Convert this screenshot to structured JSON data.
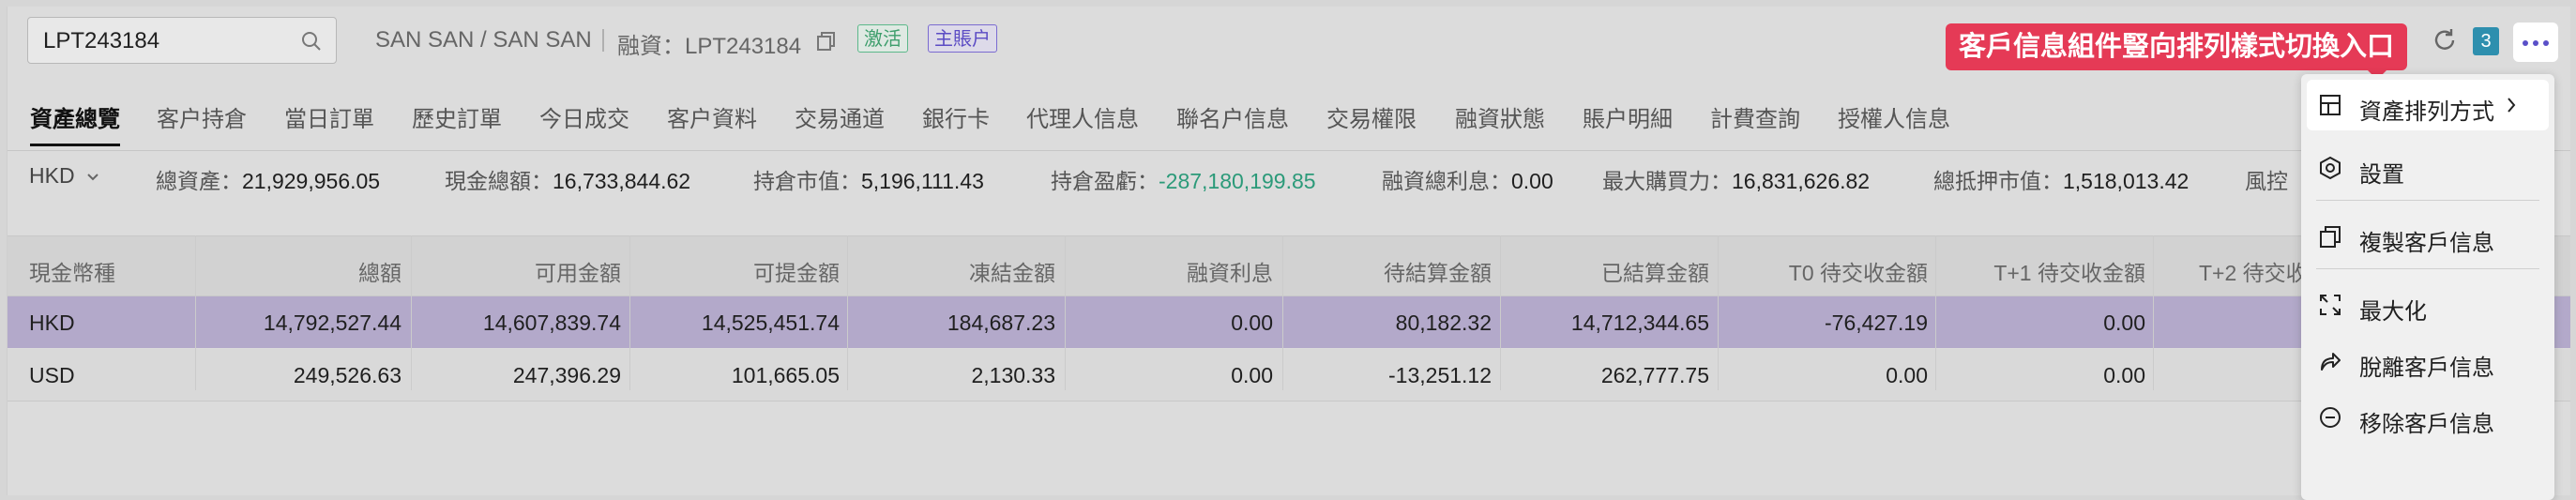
{
  "search": {
    "value": "LPT243184"
  },
  "header": {
    "client_name": "SAN SAN / SAN SAN",
    "account_label": "融資：LPT243184",
    "status_tag": "激活",
    "account_type_tag": "主賬户",
    "badge_count": "3"
  },
  "callout": "客戶信息組件豎向排列樣式切換入口",
  "tabs": [
    "資產總覽",
    "客户持倉",
    "當日訂單",
    "歷史訂單",
    "今日成交",
    "客户資料",
    "交易通道",
    "銀行卡",
    "代理人信息",
    "聯名户信息",
    "交易權限",
    "融資狀態",
    "賬户明細",
    "計費查詢",
    "授權人信息"
  ],
  "summary": {
    "currency": "HKD",
    "items": [
      {
        "label": "總資產：",
        "value": "21,929,956.05"
      },
      {
        "label": "現金總額：",
        "value": "16,733,844.62"
      },
      {
        "label": "持倉市值：",
        "value": "5,196,111.43"
      },
      {
        "label": "持倉盈虧：",
        "value": "-287,180,199.85"
      },
      {
        "label": "融資總利息：",
        "value": "0.00"
      },
      {
        "label": "最大購買力：",
        "value": "16,831,626.82"
      },
      {
        "label": "總抵押市值：",
        "value": "1,518,013.42"
      },
      {
        "label": "風控",
        "value": ""
      }
    ]
  },
  "table": {
    "headers": [
      "現金幣種",
      "總額",
      "可用金額",
      "可提金額",
      "凍結金額",
      "融資利息",
      "待結算金額",
      "已結算金額",
      "T0 待交收金額",
      "T+1 待交收金額",
      "T+2 待交收"
    ],
    "rows": [
      [
        "HKD",
        "14,792,527.44",
        "14,607,839.74",
        "14,525,451.74",
        "184,687.23",
        "0.00",
        "80,182.32",
        "14,712,344.65",
        "-76,427.19",
        "0.00"
      ],
      [
        "USD",
        "249,526.63",
        "247,396.29",
        "101,665.05",
        "2,130.33",
        "0.00",
        "-13,251.12",
        "262,777.75",
        "0.00",
        "0.00"
      ]
    ]
  },
  "menu": {
    "items": [
      {
        "label": "資產排列方式",
        "icon": "layout-icon"
      },
      {
        "label": "設置",
        "icon": "settings-icon"
      },
      {
        "label": "複製客戶信息",
        "icon": "copy-icon"
      },
      {
        "label": "最大化",
        "icon": "maximize-icon"
      },
      {
        "label": "脫離客戶信息",
        "icon": "detach-icon"
      },
      {
        "label": "移除客戶信息",
        "icon": "remove-icon"
      }
    ]
  },
  "colors": {
    "accent": "#e53a56",
    "highlight_row": "#b3a9ca",
    "positive_green": "#2b9a79",
    "badge": "#2e8fae"
  }
}
